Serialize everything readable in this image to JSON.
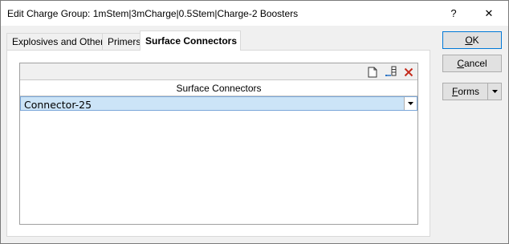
{
  "window": {
    "title": "Edit Charge Group: 1mStem|3mCharge|0.5Stem|Charge-2 Boosters",
    "help_label": "?",
    "close_label": "✕"
  },
  "tabs": [
    {
      "label": "Explosives and Others",
      "active": false
    },
    {
      "label": "Primers",
      "active": false
    },
    {
      "label": "Surface Connectors",
      "active": true
    }
  ],
  "grid": {
    "column_header": "Surface Connectors",
    "toolbar_icons": [
      "new-document-icon",
      "add-row-icon",
      "delete-icon"
    ],
    "rows": [
      {
        "value": "Connector-25",
        "selected": true
      }
    ]
  },
  "buttons": {
    "ok_accel": "O",
    "ok_rest": "K",
    "cancel_accel": "C",
    "cancel_rest": "ancel",
    "forms_accel": "F",
    "forms_rest": "orms"
  },
  "colors": {
    "selection": "#cce4f7",
    "default_button_border": "#0078d7",
    "delete_icon": "#c42b1c"
  }
}
